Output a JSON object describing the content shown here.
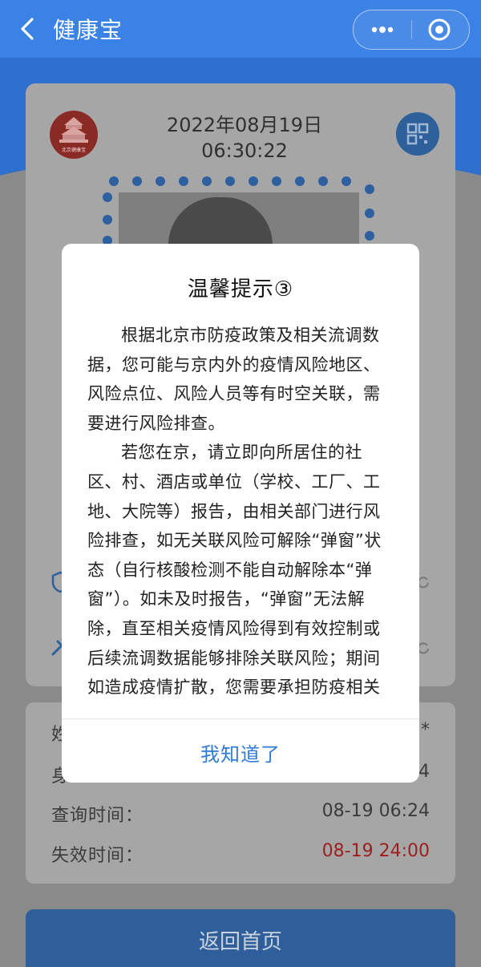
{
  "header": {
    "title": "健康宝",
    "back_icon": "chevron-left-icon",
    "more_icon": "more-dots-icon",
    "close_icon": "target-circle-icon"
  },
  "status_card": {
    "date": "2022年08月19日",
    "time": "06:30:22",
    "logo_text": "北京健康宝",
    "qr_icon": "qr-code-icon"
  },
  "info": {
    "rows": [
      {
        "label": "姓",
        "value": "*"
      },
      {
        "label": "身",
        "value": "4"
      },
      {
        "label": "查询时间：",
        "value": "08-19 06:24"
      },
      {
        "label": "失效时间：",
        "value": "08-19 24:00"
      }
    ]
  },
  "home_button": {
    "label": "返回首页"
  },
  "modal": {
    "title": "温馨提示③",
    "paragraphs": [
      "根据北京市防疫政策及相关流调数据，您可能与京内外的疫情风险地区、风险点位、风险人员等有时空关联，需要进行风险排查。",
      "若您在京，请立即向所居住的社区、村、酒店或单位（学校、工厂、工地、大院等）报告，由相关部门进行风险排查，如无关联风险可解除“弹窗”状态（自行核酸检测不能自动解除本“弹窗”）。如未及时报告，“弹窗”无法解除，直至相关疫情风险得到有效控制或后续流调数据能够排除关联风险；期间如造成疫情扩散，您需要承担防疫相关法律责任。"
    ],
    "confirm_label": "我知道了"
  },
  "colors": {
    "header_blue": "#3b82e6",
    "link_blue": "#2f7bd6",
    "expiry_red": "#9e1e1e"
  }
}
